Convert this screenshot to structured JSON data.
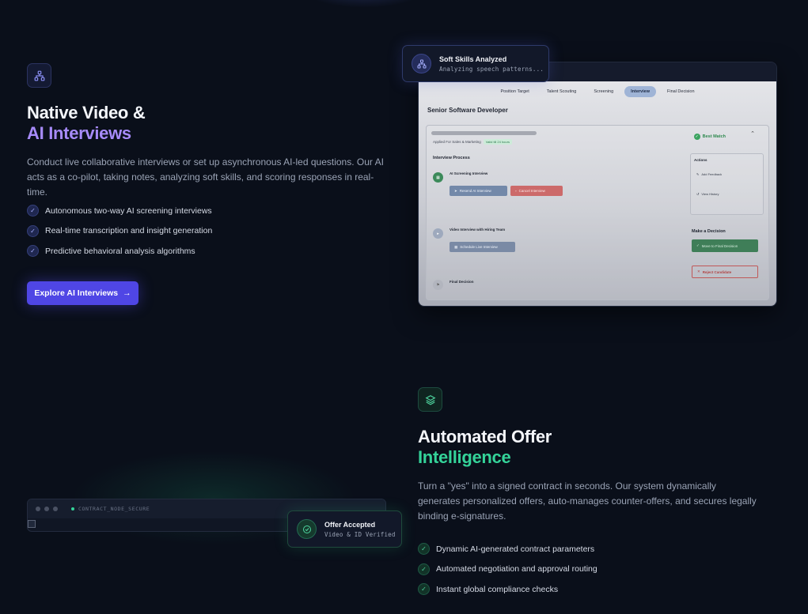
{
  "section_video": {
    "heading_line1": "Native Video &",
    "heading_line2": "AI Interviews",
    "description": "Conduct live collaborative interviews or set up asynchronous AI-led questions. Our AI acts as a co-pilot, taking notes, analyzing soft skills, and scoring responses in real-time.",
    "features": [
      "Autonomous two-way AI screening interviews",
      "Real-time transcription and insight generation",
      "Predictive behavioral analysis algorithms"
    ],
    "cta_label": "Explore AI Interviews",
    "icon": "org-chart-icon"
  },
  "soft_skills_card": {
    "title": "Soft Skills Analyzed",
    "subtitle": "Analyzing speech patterns..."
  },
  "mockup": {
    "tabs": [
      "Position Target",
      "Talent Scouting",
      "Screening",
      "Interview",
      "Final Decision"
    ],
    "active_tab": "Interview",
    "title": "Senior Software Developer",
    "applied_for": "Applied For Sales & Marketing",
    "validity_badge": "Valid till 24 hours",
    "match_label": "Best Match",
    "process_heading": "Interview Process",
    "steps": [
      {
        "label": "AI Screening Interview"
      },
      {
        "label": "Video Interview with Hiring Team"
      },
      {
        "label": "Final Decision"
      }
    ],
    "resend_label": "Resend AI Interview",
    "cancel_label": "Cancel Interview",
    "schedule_label": "Schedule Live Interview",
    "actions_heading": "Actions",
    "add_feedback": "Add Feedback",
    "view_history": "View History",
    "decision_heading": "Make a Decision",
    "move_label": "Move to Final Decision",
    "reject_label": "Reject Candidate"
  },
  "section_offer": {
    "heading_line1": "Automated Offer",
    "heading_line2": "Intelligence",
    "description": "Turn a \"yes\" into a signed contract in seconds. Our system dynamically generates personalized offers, auto-manages counter-offers, and secures legally binding e-signatures.",
    "features": [
      "Dynamic AI-generated contract parameters",
      "Automated negotiation and approval routing",
      "Instant global compliance checks"
    ],
    "icon": "layers-icon"
  },
  "contract_window": {
    "node_label": "CONTRACT_NODE_SECURE"
  },
  "offer_card": {
    "title": "Offer Accepted",
    "subtitle": "Video & ID Verified"
  },
  "colors": {
    "background": "#0a0f1a",
    "violet_accent": "#a78bfa",
    "green_accent": "#34d399",
    "cta": "#4f46e5"
  }
}
